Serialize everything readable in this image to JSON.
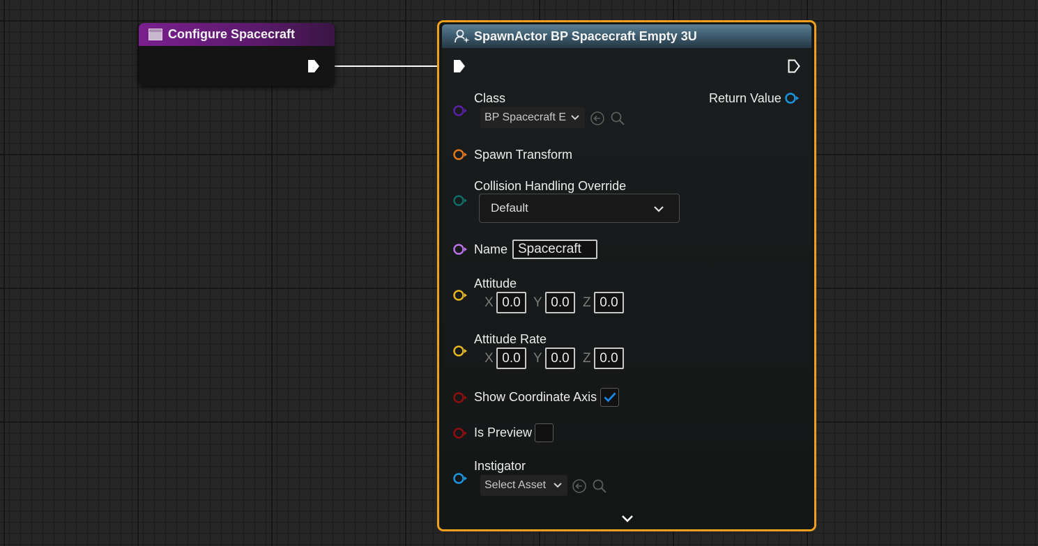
{
  "configure_node": {
    "title": "Configure Spacecraft"
  },
  "spawn_node": {
    "title": "SpawnActor BP Spacecraft Empty 3U",
    "class": {
      "label": "Class",
      "value": "BP Spacecraft E"
    },
    "return_value_label": "Return Value",
    "spawn_transform_label": "Spawn Transform",
    "collision": {
      "label": "Collision Handling Override",
      "value": "Default"
    },
    "name": {
      "label": "Name",
      "value": "Spacecraft"
    },
    "attitude": {
      "label": "Attitude",
      "x_label": "X",
      "y_label": "Y",
      "z_label": "Z",
      "x": "0.0",
      "y": "0.0",
      "z": "0.0"
    },
    "attitude_rate": {
      "label": "Attitude Rate",
      "x_label": "X",
      "y_label": "Y",
      "z_label": "Z",
      "x": "0.0",
      "y": "0.0",
      "z": "0.0"
    },
    "show_axis": {
      "label": "Show Coordinate Axis",
      "checked": true
    },
    "is_preview": {
      "label": "Is Preview",
      "checked": false
    },
    "instigator": {
      "label": "Instigator",
      "value": "Select Asset"
    }
  },
  "colors": {
    "exec": "#ffffff",
    "class_pin": "#5a1fa8",
    "struct_pin": "#e0771c",
    "enum_pin": "#0f6b68",
    "name_pin": "#b872e6",
    "vector_pin": "#e5b420",
    "bool_pin": "#8e0f0f",
    "object_pin": "#1a95e0",
    "selection_outline": "#f0a11c",
    "checkbox_accent": "#1a86e8"
  }
}
